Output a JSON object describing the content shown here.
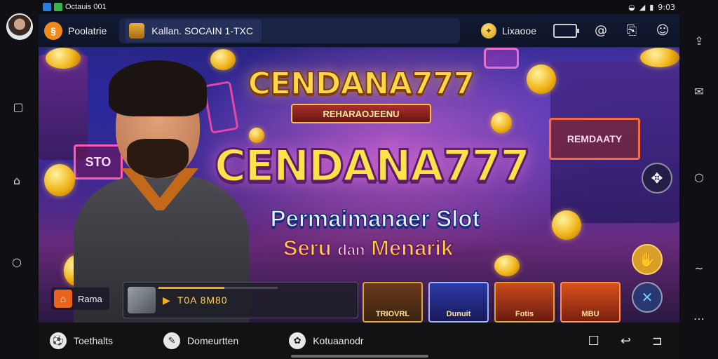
{
  "status_bar": {
    "left_text": "Octauis 001",
    "right_text": "9:03"
  },
  "app_header": {
    "logo_icon": "coin-logo-icon",
    "brand": "Poolatrie",
    "search_chip_text": "Kallan. SOCAIN 1-TXC",
    "credits_label": "Lixaooe",
    "icons": [
      "coin-icon",
      "battery-box-icon",
      "at-icon",
      "clipboard-icon",
      "profile-icon"
    ]
  },
  "banner": {
    "logo_top_title": "CENDANA777",
    "logo_top_ribbon": "REHARAOJEENU",
    "big_title": "CENDANA777",
    "subtitle_line1": "Permaimanaer Slot",
    "subtitle_line2_a": "Seru",
    "subtitle_line2_b": "dan",
    "subtitle_line2_c": "Menarik",
    "signboards": [
      "STO",
      "REMDAATY"
    ],
    "home_button_label": "Rama",
    "media_text": "T0A 8M80",
    "media_progress": 0.55,
    "game_tiles": [
      "TRIOVRL",
      "Dunuit",
      "Fotis",
      "MBU"
    ],
    "colors": {
      "accent_gold": "#ffd84a",
      "accent_pink": "#ff78dc",
      "accent_orange": "#f08a1c"
    }
  },
  "bottom_nav": {
    "items": [
      {
        "label": "Toethalts",
        "icon": "soccer-icon"
      },
      {
        "label": "Domeurtten",
        "icon": "chat-icon"
      },
      {
        "label": "Kotuaanodr",
        "icon": "gear-icon"
      }
    ],
    "system_icons": [
      "square-icon",
      "back-arrow-icon",
      "return-icon"
    ]
  }
}
